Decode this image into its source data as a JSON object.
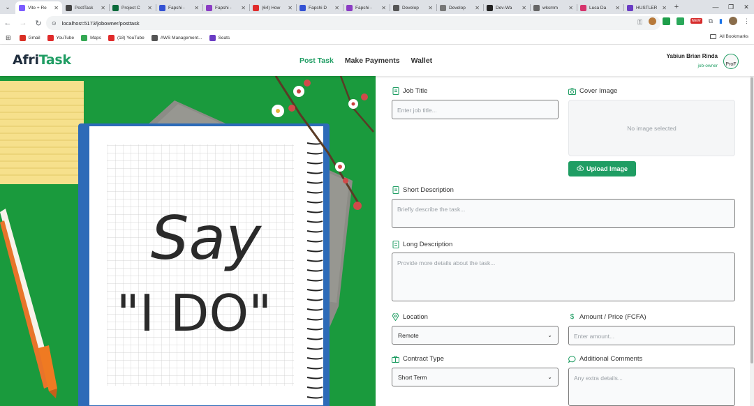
{
  "browser": {
    "tabs": [
      {
        "title": "Vite + Re",
        "color": "#7b5cff",
        "active": true
      },
      {
        "title": "PostTask",
        "color": "#444444",
        "active": false
      },
      {
        "title": "Project C",
        "color": "#0a6a3a",
        "active": false
      },
      {
        "title": "Fapshi -",
        "color": "#3452d4",
        "active": false
      },
      {
        "title": "Fapshi -",
        "color": "#8b3cc4",
        "active": false
      },
      {
        "title": "(64) How",
        "color": "#e02b2b",
        "active": false
      },
      {
        "title": "Fapshi D",
        "color": "#3452d4",
        "active": false
      },
      {
        "title": "Fapshi -",
        "color": "#8b3cc4",
        "active": false
      },
      {
        "title": "Develop",
        "color": "#555555",
        "active": false
      },
      {
        "title": "Develop",
        "color": "#777777",
        "active": false
      },
      {
        "title": "Dev-Wa",
        "color": "#222222",
        "active": false
      },
      {
        "title": "wksmm",
        "color": "#666666",
        "active": false
      },
      {
        "title": "Luca Da",
        "color": "#d6336c",
        "active": false
      },
      {
        "title": "HUSTLER",
        "color": "#6a3cc4",
        "active": false
      }
    ],
    "url": "localhost:5173/jobowner/posttask",
    "bookmarks": [
      {
        "label": "Gmail",
        "color": "#d93025"
      },
      {
        "label": "YouTube",
        "color": "#e02b2b"
      },
      {
        "label": "Maps",
        "color": "#34a853"
      },
      {
        "label": "(18) YouTube",
        "color": "#e02b2b"
      },
      {
        "label": "AWS Management...",
        "color": "#555555"
      },
      {
        "label": "Seats",
        "color": "#6a3cc4"
      }
    ],
    "all_bookmarks": "All Bookmarks",
    "new_badge": "NEW"
  },
  "app": {
    "logo_part1": "Afri",
    "logo_part2": "Task",
    "nav": [
      {
        "label": "Post Task",
        "active": true
      },
      {
        "label": "Make Payments",
        "active": false
      },
      {
        "label": "Wallet",
        "active": false
      }
    ],
    "user_name": "Yabiun Brian Rinda",
    "user_role": "job-owner",
    "avatar_alt": "ProF"
  },
  "hero": {
    "line1": "Say",
    "line2": "\"I DO\""
  },
  "form": {
    "job_title": {
      "label": "Job Title",
      "placeholder": "Enter job title..."
    },
    "cover_image": {
      "label": "Cover Image",
      "empty_text": "No image selected",
      "button": "Upload Image"
    },
    "short_description": {
      "label": "Short Description",
      "placeholder": "Briefly describe the task..."
    },
    "long_description": {
      "label": "Long Description",
      "placeholder": "Provide more details about the task..."
    },
    "location": {
      "label": "Location",
      "value": "Remote"
    },
    "amount": {
      "label": "Amount / Price (FCFA)",
      "placeholder": "Enter amount..."
    },
    "contract_type": {
      "label": "Contract Type",
      "value": "Short Term"
    },
    "comments": {
      "label": "Additional Comments",
      "placeholder": "Any extra details..."
    }
  },
  "colors": {
    "brand_green": "#1f9d63",
    "brand_dark": "#1f2d3d",
    "hero_green": "#1a9a3d"
  }
}
